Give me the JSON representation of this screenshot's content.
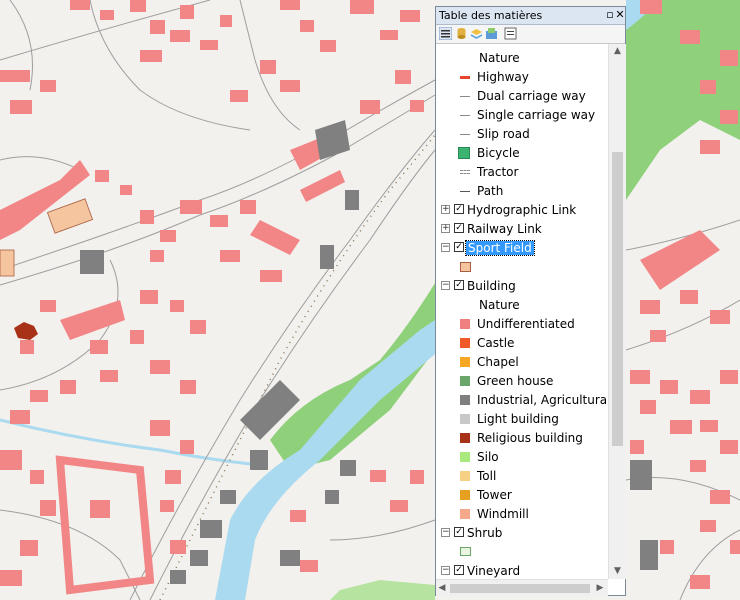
{
  "panel": {
    "title": "Table des matières",
    "pin_icon": "pin-icon",
    "close_icon": "close-icon",
    "toolbar_icons": [
      "list-by-drawing-order-icon",
      "list-by-source-icon",
      "list-by-visibility-icon",
      "list-by-selection-icon",
      "options-icon"
    ]
  },
  "tree": {
    "nature_header_1": "Nature",
    "roads": [
      {
        "label": "Highway",
        "color": "#e8442c"
      },
      {
        "label": "Dual carriage way",
        "color": "#8a8a8a"
      },
      {
        "label": "Single carriage way",
        "color": "#8a8a8a"
      },
      {
        "label": "Slip road",
        "color": "#8a8a8a"
      },
      {
        "label": "Bicycle",
        "color": "#3cb371"
      },
      {
        "label": "Tractor",
        "color": "#8a8a8a"
      },
      {
        "label": "Path",
        "color": "#555555"
      }
    ],
    "layers": [
      {
        "label": "Hydrographic Link",
        "expanded": false,
        "checked": true
      },
      {
        "label": "Railway Link",
        "expanded": false,
        "checked": true
      },
      {
        "label": "Sport Field",
        "expanded": true,
        "checked": true,
        "selected": true
      },
      {
        "label": "Building",
        "expanded": true,
        "checked": true
      }
    ],
    "nature_header_2": "Nature",
    "buildings": [
      {
        "label": "Undifferentiated",
        "color": "#f08080"
      },
      {
        "label": "Castle",
        "color": "#f05a28"
      },
      {
        "label": "Chapel",
        "color": "#f5a623"
      },
      {
        "label": "Green house",
        "color": "#6aa56a"
      },
      {
        "label": "Industrial, Agricultural, C",
        "color": "#7f7f7f"
      },
      {
        "label": "Light building",
        "color": "#c8c8c8"
      },
      {
        "label": "Religious building",
        "color": "#a83218"
      },
      {
        "label": "Silo",
        "color": "#a8e87c"
      },
      {
        "label": "Toll",
        "color": "#f7cf85"
      },
      {
        "label": "Tower",
        "color": "#e6a020"
      },
      {
        "label": "Windmill",
        "color": "#f5a98a"
      }
    ],
    "bottom_layers": [
      {
        "label": "Shrub",
        "expanded": true,
        "checked": true
      },
      {
        "label": "Vineyard",
        "expanded": true,
        "checked": true
      }
    ]
  },
  "colors": {
    "map_bg": "#f3f1ee",
    "water": "#aadaf0",
    "vegetation": "#8fd07a",
    "building": "#f28585",
    "industrial": "#808080",
    "road": "#ffffff",
    "road_edge": "#9e9e9e"
  }
}
